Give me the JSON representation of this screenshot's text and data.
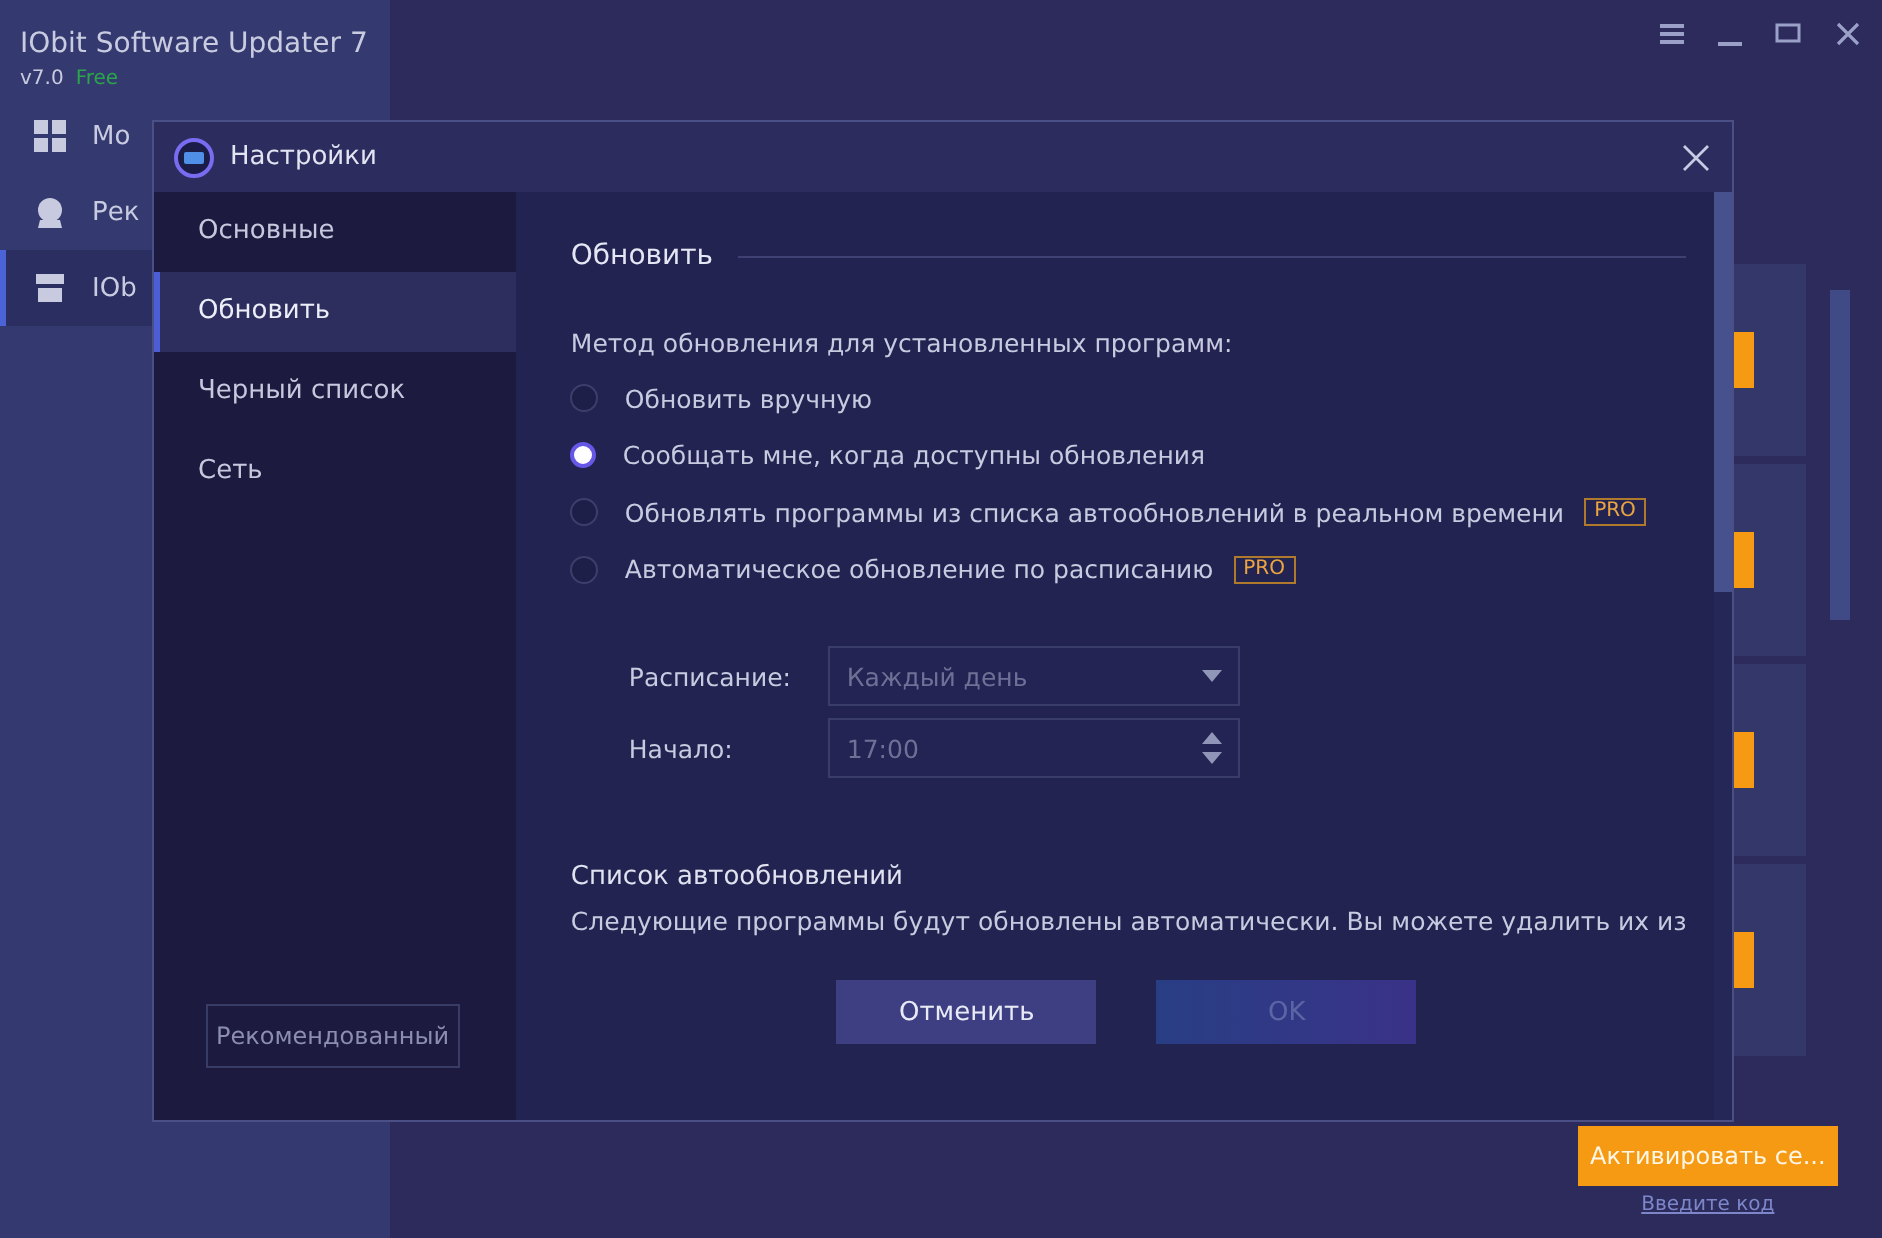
{
  "app": {
    "title": "IObit Software Updater 7",
    "version": "v7.0",
    "edition": "Free",
    "sidebar": [
      {
        "label": "Мо",
        "selected": false
      },
      {
        "label": "Рек",
        "selected": false
      },
      {
        "label": "IOb",
        "selected": true
      }
    ],
    "activate_button": "Активировать се...",
    "code_link": "Введите код"
  },
  "dialog": {
    "title": "Настройки",
    "nav": [
      {
        "label": "Основные",
        "selected": false
      },
      {
        "label": "Обновить",
        "selected": true
      },
      {
        "label": "Черный список",
        "selected": false
      },
      {
        "label": "Сеть",
        "selected": false
      }
    ],
    "recommended_button": "Рекомендованный",
    "section_title": "Обновить",
    "method_label": "Метод обновления для установленных программ:",
    "options": [
      {
        "label": "Обновить вручную",
        "selected": false
      },
      {
        "label": "Сообщать мне, когда доступны обновления",
        "selected": true
      },
      {
        "label": "Обновлять программы из списка автообновлений в реальном времени",
        "selected": false,
        "badge": "PRO"
      },
      {
        "label": "Автоматическое обновление по расписанию",
        "selected": false,
        "badge": "PRO"
      }
    ],
    "fields": [
      {
        "kind": "dropdown",
        "label": "Расписание:",
        "value": "Каждый день",
        "disabled": true
      },
      {
        "kind": "spinner",
        "label": "Начало:",
        "value": "17:00",
        "disabled": true
      }
    ],
    "autolist_title": "Список автообновлений",
    "autolist_text": "Следующие программы будут обновлены автоматически. Вы можете удалить их из",
    "buttons": [
      {
        "label": "Отменить",
        "disabled": false
      },
      {
        "label": "OK",
        "disabled": true
      }
    ]
  }
}
